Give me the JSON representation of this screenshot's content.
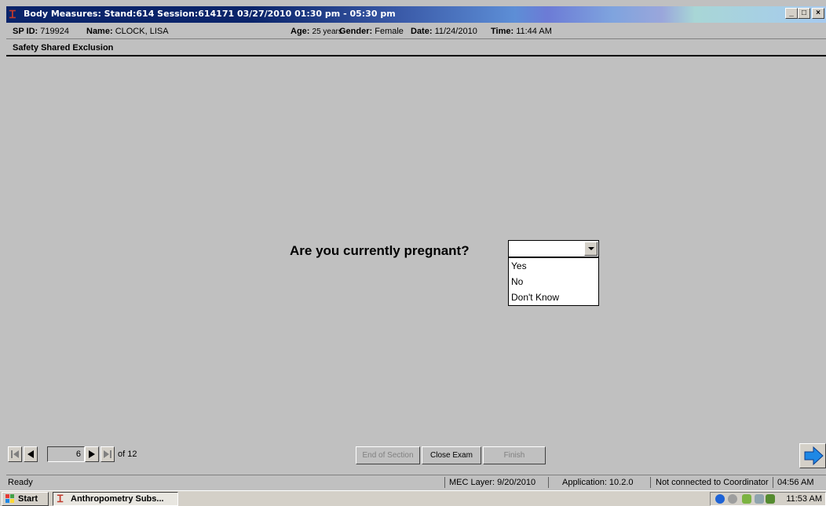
{
  "window": {
    "title": "Body Measures: Stand:614 Session:614171 03/27/2010 01:30 pm - 05:30 pm",
    "buttons": {
      "minimize": "_",
      "maximize": "□",
      "close": "×"
    }
  },
  "participant": {
    "sp_id_label": "SP ID:",
    "sp_id": "719924",
    "name_label": "Name:",
    "name": "CLOCK, LISA",
    "age_label": "Age:",
    "age": "25 years",
    "gender_label": "Gender:",
    "gender": "Female",
    "date_label": "Date:",
    "date": "11/24/2010",
    "time_label": "Time:",
    "time": "11:44 AM"
  },
  "section": {
    "title": "Safety Shared Exclusion"
  },
  "question": {
    "text": "Are you currently pregnant?",
    "selected": "",
    "options": [
      "Yes",
      "No",
      "Don't Know"
    ]
  },
  "navigation": {
    "page": "6",
    "of_pages": "of 12"
  },
  "actions": {
    "end_of_section": "End of Section",
    "close_exam": "Close Exam",
    "finish": "Finish"
  },
  "status": {
    "state": "Ready",
    "mec_layer": "MEC Layer: 9/20/2010",
    "application": "Application: 10.2.0",
    "coordinator": "Not connected to Coordinator",
    "time": "04:56 AM"
  },
  "taskbar": {
    "start": "Start",
    "task": "Anthropometry Subs...",
    "clock": "11:53 AM"
  },
  "colors": {
    "background": "#c0c0c0",
    "titlebar": "#0a246a",
    "next_arrow": "#1e88e5"
  }
}
